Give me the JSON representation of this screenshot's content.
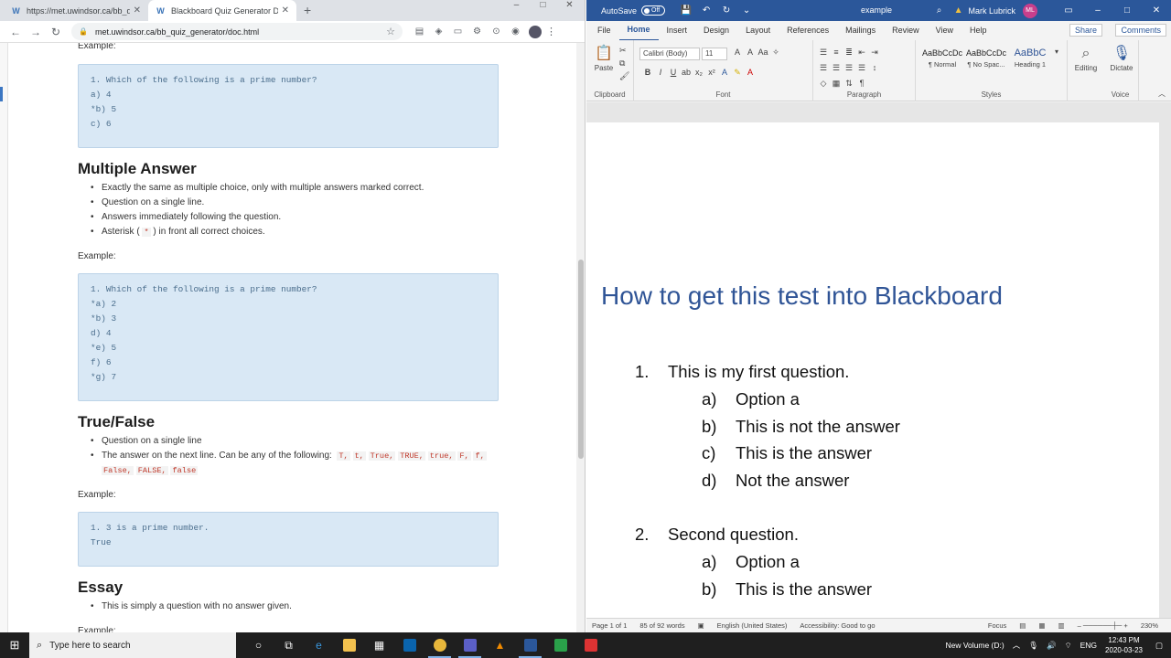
{
  "chrome": {
    "tabs": [
      {
        "title": "https://met.uwindsor.ca/bb_quiz"
      },
      {
        "title": "Blackboard Quiz Generator Doc"
      }
    ],
    "url": "met.uwindsor.ca/bb_quiz_generator/doc.html"
  },
  "doc": {
    "example_label": "Example:",
    "mc_code": "1. Which of the following is a prime number?\na) 4\n*b) 5\nc) 6",
    "ma_heading": "Multiple Answer",
    "ma_bullets": [
      "Exactly the same as multiple choice, only with multiple answers marked correct.",
      "Question on a single line.",
      "Answers immediately following the question."
    ],
    "ma_asterisk_pre": "Asterisk (",
    "ma_asterisk_code": "*",
    "ma_asterisk_post": ") in front all correct choices.",
    "ma_code": "1. Which of the following is a prime number?\n*a) 2\n*b) 3\nd) 4\n*e) 5\nf) 6\n*g) 7",
    "tf_heading": "True/False",
    "tf_bullet1": "Question on a single line",
    "tf_bullet2_pre": "The answer on the next line. Can be any of the following:",
    "tf_values": [
      "T,",
      "t,",
      "True,",
      "TRUE,",
      "true,",
      "F,",
      "f,",
      "False,",
      "FALSE,",
      "false"
    ],
    "tf_code": "1. 3 is a prime number.\nTrue",
    "essay_heading": "Essay",
    "essay_bullet": "This is simply a question with no answer given."
  },
  "word": {
    "autosave_label": "AutoSave",
    "autosave_state": "Off",
    "doc_name": "example",
    "user_name": "Mark Lubrick",
    "user_initials": "ML",
    "tabs": [
      "File",
      "Home",
      "Insert",
      "Design",
      "Layout",
      "References",
      "Mailings",
      "Review",
      "View",
      "Help"
    ],
    "share": "Share",
    "comments": "Comments",
    "ribbon": {
      "paste": "Paste",
      "clipboard": "Clipboard",
      "font_name": "Calibri (Body)",
      "font_size": "11",
      "font": "Font",
      "paragraph": "Paragraph",
      "styles": "Styles",
      "style_items": [
        {
          "preview": "AaBbCcDc",
          "name": "¶ Normal"
        },
        {
          "preview": "AaBbCcDc",
          "name": "¶ No Spac..."
        },
        {
          "preview": "AaBbC",
          "name": "Heading 1"
        }
      ],
      "editing": "Editing",
      "dictate": "Dictate",
      "voice": "Voice"
    },
    "title": "How to get this test into Blackboard",
    "questions": [
      {
        "num": "1.",
        "text": "This is my first question.",
        "options": [
          {
            "letter": "a)",
            "text": "Option a"
          },
          {
            "letter": "b)",
            "text": "This is not the answer"
          },
          {
            "letter": "c)",
            "text": "This is the answer"
          },
          {
            "letter": "d)",
            "text": "Not the answer"
          }
        ]
      },
      {
        "num": "2.",
        "text": "Second question.",
        "options": [
          {
            "letter": "a)",
            "text": "Option a"
          },
          {
            "letter": "b)",
            "text": "This is the answer"
          }
        ]
      }
    ],
    "status": {
      "page": "Page 1 of 1",
      "words": "85 of 92 words",
      "language": "English (United States)",
      "accessibility": "Accessibility: Good to go",
      "focus": "Focus",
      "zoom": "230%"
    }
  },
  "taskbar": {
    "search_placeholder": "Type here to search",
    "drive": "New Volume (D:)",
    "lang": "ENG",
    "time": "12:43 PM",
    "date": "2020-03-23"
  }
}
